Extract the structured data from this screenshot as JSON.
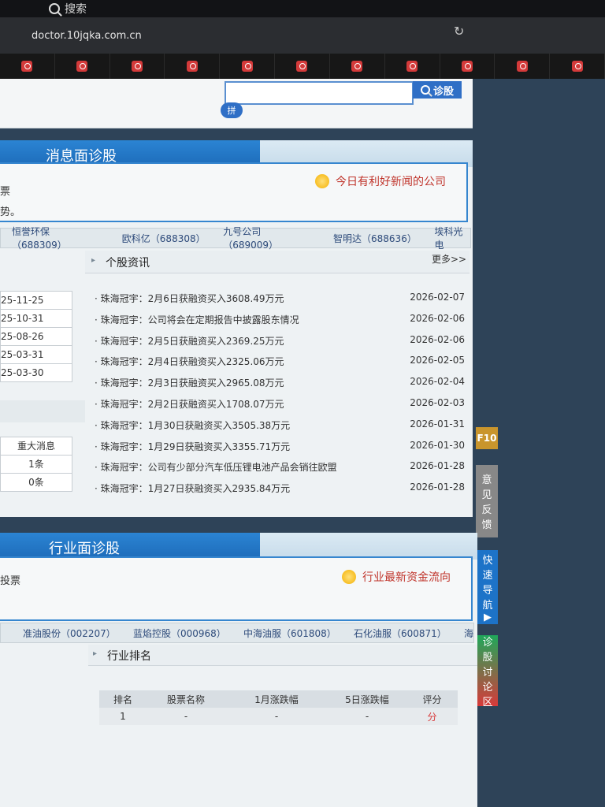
{
  "browser": {
    "tab_label": "搜索",
    "url": "doctor.10jqka.com.cn"
  },
  "search": {
    "button_label": "诊股",
    "pinyin_label": "拼"
  },
  "news_section": {
    "title": "消息面诊股",
    "left_text_1": "票",
    "left_text_2": "势。",
    "badge": "今日有利好新闻的公司",
    "stocks": [
      "恒誉环保（688309）",
      "欧科亿（688308）",
      "九号公司（689009）",
      "智明达（688636）",
      "埃科光电"
    ],
    "left_dates": [
      "25-11-25",
      "25-10-31",
      "25-08-26",
      "25-03-31",
      "25-03-30"
    ],
    "left_header": "重大消息",
    "left_counts": [
      "1条",
      "0条"
    ],
    "news_header": "个股资讯",
    "more": "更多>>",
    "items": [
      {
        "title": "珠海冠宇：2月6日获融资买入3608.49万元",
        "date": "2026-02-07"
      },
      {
        "title": "珠海冠宇：公司将会在定期报告中披露股东情况",
        "date": "2026-02-06"
      },
      {
        "title": "珠海冠宇：2月5日获融资买入2369.25万元",
        "date": "2026-02-06"
      },
      {
        "title": "珠海冠宇：2月4日获融资买入2325.06万元",
        "date": "2026-02-05"
      },
      {
        "title": "珠海冠宇：2月3日获融资买入2965.08万元",
        "date": "2026-02-04"
      },
      {
        "title": "珠海冠宇：2月2日获融资买入1708.07万元",
        "date": "2026-02-03"
      },
      {
        "title": "珠海冠宇：1月30日获融资买入3505.38万元",
        "date": "2026-01-31"
      },
      {
        "title": "珠海冠宇：1月29日获融资买入3355.71万元",
        "date": "2026-01-30"
      },
      {
        "title": "珠海冠宇：公司有少部分汽车低压锂电池产品会销往欧盟",
        "date": "2026-01-28"
      },
      {
        "title": "珠海冠宇：1月27日获融资买入2935.84万元",
        "date": "2026-01-28"
      }
    ]
  },
  "tools": {
    "f10": "F10",
    "feedback": [
      "意",
      "见",
      "反",
      "馈"
    ],
    "nav": [
      "快",
      "速",
      "导",
      "航",
      "▶"
    ],
    "forum": [
      "诊",
      "股",
      "讨",
      "论",
      "区"
    ]
  },
  "industry_section": {
    "title": "行业面诊股",
    "left_text": "投票",
    "badge": "行业最新资金流向",
    "stocks": [
      "准油股份（002207）",
      "蓝焰控股（000968）",
      "中海油服（601808）",
      "石化油服（600871）",
      "海"
    ],
    "rank_header": "行业排名",
    "table_headers": [
      "排名",
      "股票名称",
      "1月涨跌幅",
      "5日涨跌幅",
      "评分"
    ],
    "table_row": [
      "1",
      "-",
      "-",
      "-",
      "分"
    ]
  }
}
